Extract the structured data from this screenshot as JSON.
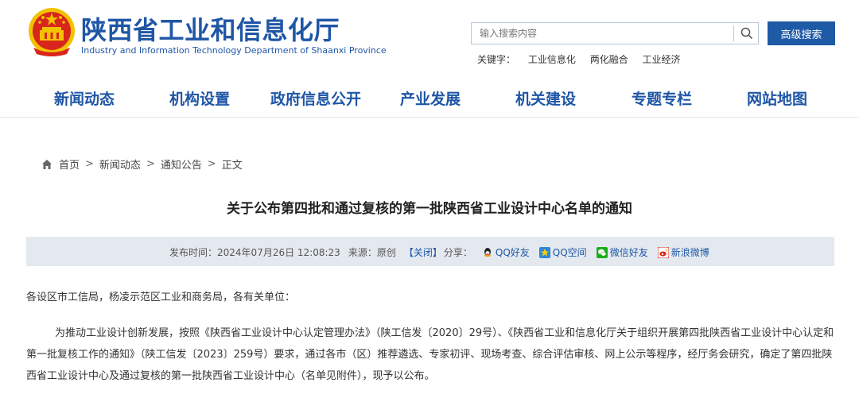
{
  "site": {
    "title_cn": "陕西省工业和信息化厅",
    "title_en": "Industry and Information Technology Department of Shaanxi Province"
  },
  "search": {
    "placeholder": "输入搜索内容",
    "advanced_label": "高级搜索",
    "keywords_label": "关键字：",
    "keywords": [
      "工业信息化",
      "两化融合",
      "工业经济"
    ]
  },
  "nav": {
    "items": [
      "新闻动态",
      "机构设置",
      "政府信息公开",
      "产业发展",
      "机关建设",
      "专题专栏",
      "网站地图"
    ]
  },
  "breadcrumb": {
    "items": [
      "首页",
      "新闻动态",
      "通知公告",
      "正文"
    ],
    "separator": ">"
  },
  "article": {
    "title": "关于公布第四批和通过复核的第一批陕西省工业设计中心名单的通知",
    "meta": {
      "publish_label": "发布时间：",
      "publish_time": "2024年07月26日 12:08:23",
      "source_label": "来源：",
      "source": "原创",
      "close_label": "【关闭】",
      "share_label": "分享：",
      "share": [
        "QQ好友",
        "QQ空间",
        "微信好友",
        "新浪微博"
      ]
    },
    "salutation": "各设区市工信局，杨凌示范区工业和商务局，各有关单位：",
    "paragraph": "为推动工业设计创新发展，按照《陕西省工业设计中心认定管理办法》（陕工信发〔2020〕29号）、《陕西省工业和信息化厅关于组织开展第四批陕西省工业设计中心认定和第一批复核工作的通知》（陕工信发〔2023〕259号）要求，通过各市（区）推荐遴选、专家初评、现场考查、综合评估审核、网上公示等程序，经厅务会研究，确定了第四批陕西省工业设计中心及通过复核的第一批陕西省工业设计中心（名单见附件），现予以公布。"
  },
  "colors": {
    "brand_blue": "#1f56a6",
    "meta_bar": "#e4e9ef",
    "emblem_red": "#d8261d",
    "emblem_gold": "#f2c200"
  }
}
